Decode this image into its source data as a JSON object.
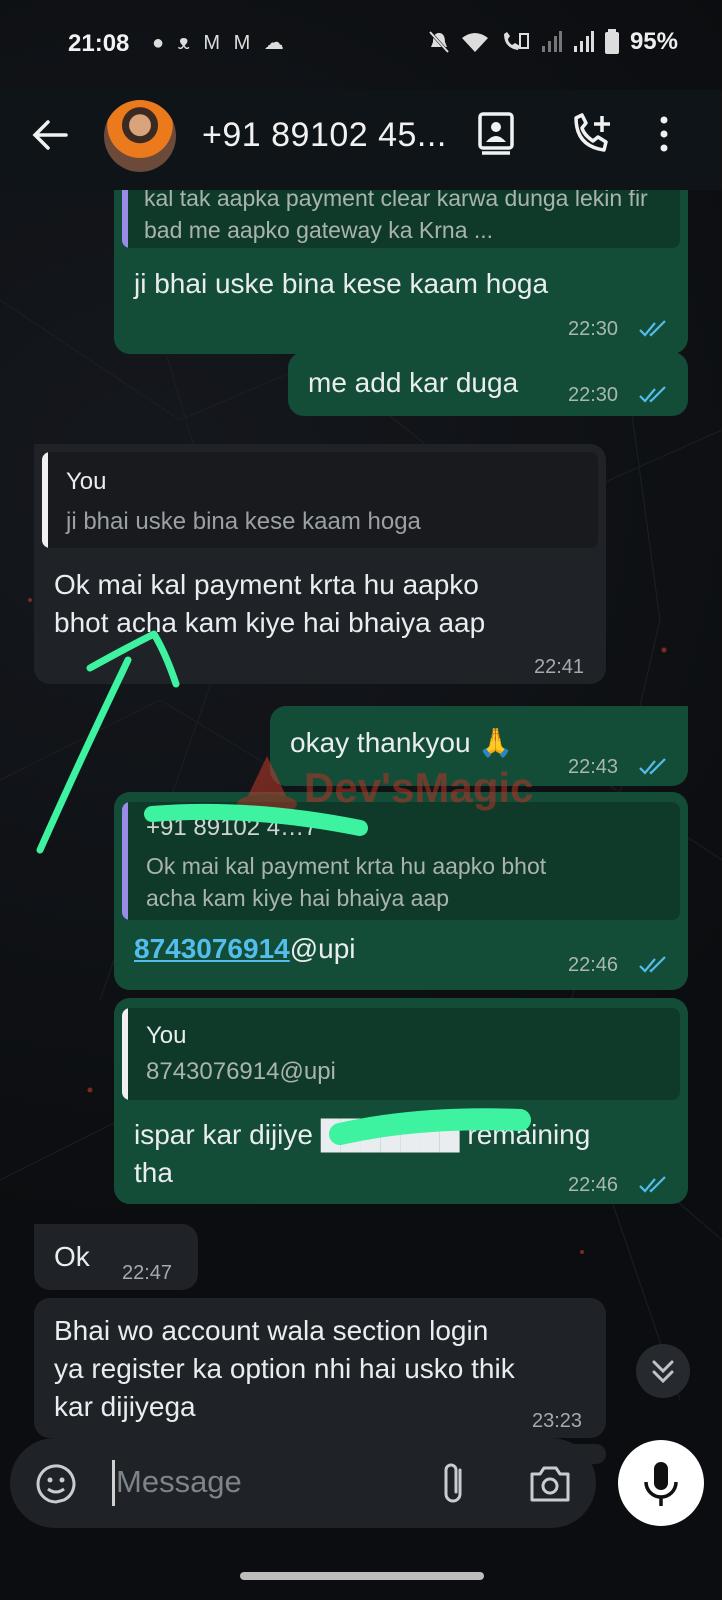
{
  "status_bar": {
    "time": "21:08",
    "left_icons": [
      "chat-icon",
      "missed-call-icon",
      "gmail-icon",
      "gmail-icon",
      "cloud-icon"
    ],
    "right_icons": [
      "mute-icon",
      "wifi-icon",
      "volte-icon",
      "signal-icon",
      "signal-icon",
      "battery-icon"
    ],
    "battery": "95%"
  },
  "header": {
    "contact_name": "+91 89102 45...",
    "icons": [
      "back-arrow-icon",
      "contact-card-icon",
      "add-call-icon",
      "more-options-icon"
    ]
  },
  "messages": [
    {
      "id": "m1",
      "direction": "out",
      "quote_text": "kal tak aapka payment clear karwa dunga lekin fir bad me aapko gateway ka Krna ...",
      "text": "ji bhai uske bina kese kaam hoga",
      "time": "22:30",
      "status": "read"
    },
    {
      "id": "m2",
      "direction": "out",
      "text": "me add kar duga",
      "time": "22:30",
      "status": "read"
    },
    {
      "id": "m3",
      "direction": "in",
      "quote_name": "You",
      "quote_text": "ji bhai uske bina kese kaam hoga",
      "text_line1": "Ok mai kal payment krta hu aapko",
      "text_line2": "bhot acha kam kiye hai bhaiya aap",
      "time": "22:41"
    },
    {
      "id": "m4",
      "direction": "out",
      "text": "okay thankyou 🙏",
      "time": "22:43",
      "status": "read"
    },
    {
      "id": "m5",
      "direction": "out",
      "quote_name": "+91 89102 4…7",
      "quote_text_line1": "Ok mai kal payment krta hu aapko bhot",
      "quote_text_line2": "acha kam kiye hai bhaiya aap",
      "link": "8743076914",
      "link_suffix": "@upi",
      "time": "22:46",
      "status": "read"
    },
    {
      "id": "m6",
      "direction": "out",
      "quote_name": "You",
      "quote_text": "8743076914@upi",
      "text_line1": "ispar kar dijiye ███████ remaining",
      "text_line2": "tha",
      "time": "22:46",
      "status": "read"
    },
    {
      "id": "m7",
      "direction": "in",
      "text": "Ok",
      "time": "22:47"
    },
    {
      "id": "m8",
      "direction": "in",
      "text_line1": "Bhai wo account wala section login",
      "text_line2": "ya register ka option nhi hai usko thik",
      "text_line3": "kar dijiyega",
      "time": "23:23"
    }
  ],
  "watermark": "Dev'sMagic",
  "composer": {
    "placeholder": "Message",
    "icons": [
      "sticker-icon",
      "attach-icon",
      "camera-icon",
      "mic-icon",
      "scroll-down-icon"
    ]
  },
  "colors": {
    "outgoing_bubble": "#144d37",
    "incoming_bubble": "#1f2226",
    "read_ticks": "#53bdeb",
    "annotation_arrow": "#3ef3a0"
  }
}
